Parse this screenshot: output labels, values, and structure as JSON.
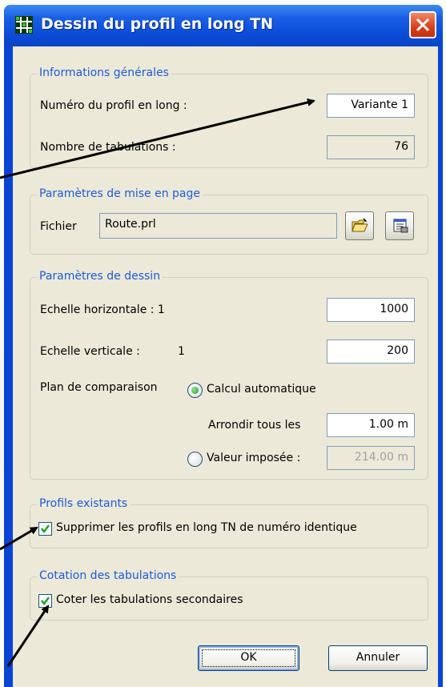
{
  "window": {
    "title": "Dessin du profil en long TN"
  },
  "general": {
    "legend": "Informations générales",
    "profile_number_label": "Numéro du profil en long :",
    "profile_number_value": "Variante 1",
    "tabs_count_label": "Nombre de tabulations :",
    "tabs_count_value": "76"
  },
  "layout": {
    "legend": "Paramètres de mise en page",
    "file_label": "Fichier",
    "file_value": "Route.prl",
    "icons": [
      "open-folder-icon",
      "properties-icon"
    ]
  },
  "drawing": {
    "legend": "Paramètres de dessin",
    "h_scale_label": "Echelle horizontale : 1",
    "h_scale_value": "1000",
    "v_scale_label": "Echelle verticale :",
    "v_scale_prefix": "1",
    "v_scale_value": "200",
    "comparison_label": "Plan de comparaison",
    "auto_label": "Calcul automatique",
    "auto_selected": true,
    "round_label": "Arrondir tous les",
    "round_value": "1.00 m",
    "imposed_label": "Valeur imposée :",
    "imposed_value": "214.00 m"
  },
  "existing": {
    "legend": "Profils existants",
    "delete_label": "Supprimer les profils en long TN de numéro identique",
    "delete_checked": true
  },
  "dimensioning": {
    "legend": "Cotation des tabulations",
    "secondary_label": "Coter les tabulations secondaires",
    "secondary_checked": true
  },
  "buttons": {
    "ok": "OK",
    "cancel": "Annuler"
  },
  "colors": {
    "titlebar": "#0a44d6",
    "legend_text": "#1d5ad8",
    "dialog_bg": "#ece9d8",
    "close": "#d8401c"
  }
}
